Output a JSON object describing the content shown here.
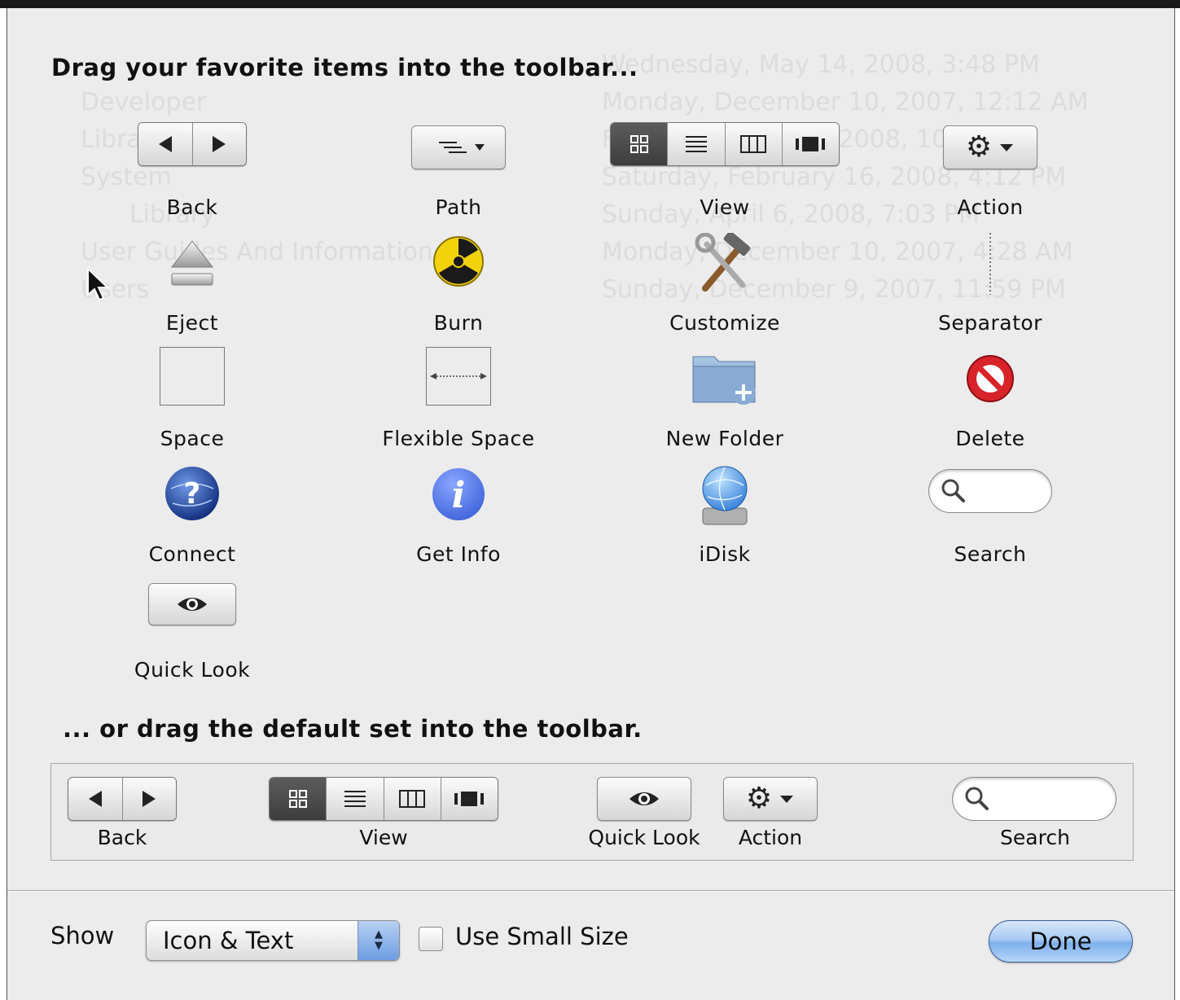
{
  "heading_top": "Drag your favorite items into the toolbar...",
  "heading_default": "... or drag the default set into the toolbar.",
  "items": [
    {
      "label": "Back",
      "icon": "back-forward-icon"
    },
    {
      "label": "Path",
      "icon": "path-icon"
    },
    {
      "label": "View",
      "icon": "view-segment-icon"
    },
    {
      "label": "Action",
      "icon": "gear-icon"
    },
    {
      "label": "Eject",
      "icon": "eject-icon"
    },
    {
      "label": "Burn",
      "icon": "burn-icon"
    },
    {
      "label": "Customize",
      "icon": "customize-icon"
    },
    {
      "label": "Separator",
      "icon": "separator-icon"
    },
    {
      "label": "Space",
      "icon": "space-icon"
    },
    {
      "label": "Flexible Space",
      "icon": "flexible-space-icon"
    },
    {
      "label": "New Folder",
      "icon": "new-folder-icon"
    },
    {
      "label": "Delete",
      "icon": "delete-icon"
    },
    {
      "label": "Connect",
      "icon": "connect-icon"
    },
    {
      "label": "Get Info",
      "icon": "get-info-icon"
    },
    {
      "label": "iDisk",
      "icon": "idisk-icon"
    },
    {
      "label": "Search",
      "icon": "search-icon"
    },
    {
      "label": "Quick Look",
      "icon": "eye-icon"
    }
  ],
  "default_set": [
    {
      "label": "Back"
    },
    {
      "label": "View"
    },
    {
      "label": "Quick Look"
    },
    {
      "label": "Action"
    },
    {
      "label": "Search"
    }
  ],
  "footer": {
    "show_label": "Show",
    "show_value": "Icon & Text",
    "small_size_label": "Use Small Size",
    "small_size_checked": false,
    "done_label": "Done"
  },
  "background_rows": [
    {
      "date": "Wednesday, May 14, 2008, 3:48 PM"
    },
    {
      "name": "Developer",
      "date": "Monday, December 10, 2007, 12:12 AM"
    },
    {
      "name": "Library",
      "date": "Friday, January 11, 2008, 10:20 PM"
    },
    {
      "name": "System",
      "date": "Saturday, February 16, 2008, 4:12 PM"
    },
    {
      "name": "Library",
      "date": "Sunday, April 6, 2008, 7:03 PM"
    },
    {
      "name": "User Guides And Information",
      "date": "Monday, December 10, 2007, 4:28 AM"
    },
    {
      "name": "Users",
      "date": "Sunday, December 9, 2007, 11:59 PM"
    }
  ],
  "colors": {
    "sheet_bg": "#ececec",
    "done_blue": "#7fb0ec",
    "selected_segment": "#4a4a4a"
  }
}
